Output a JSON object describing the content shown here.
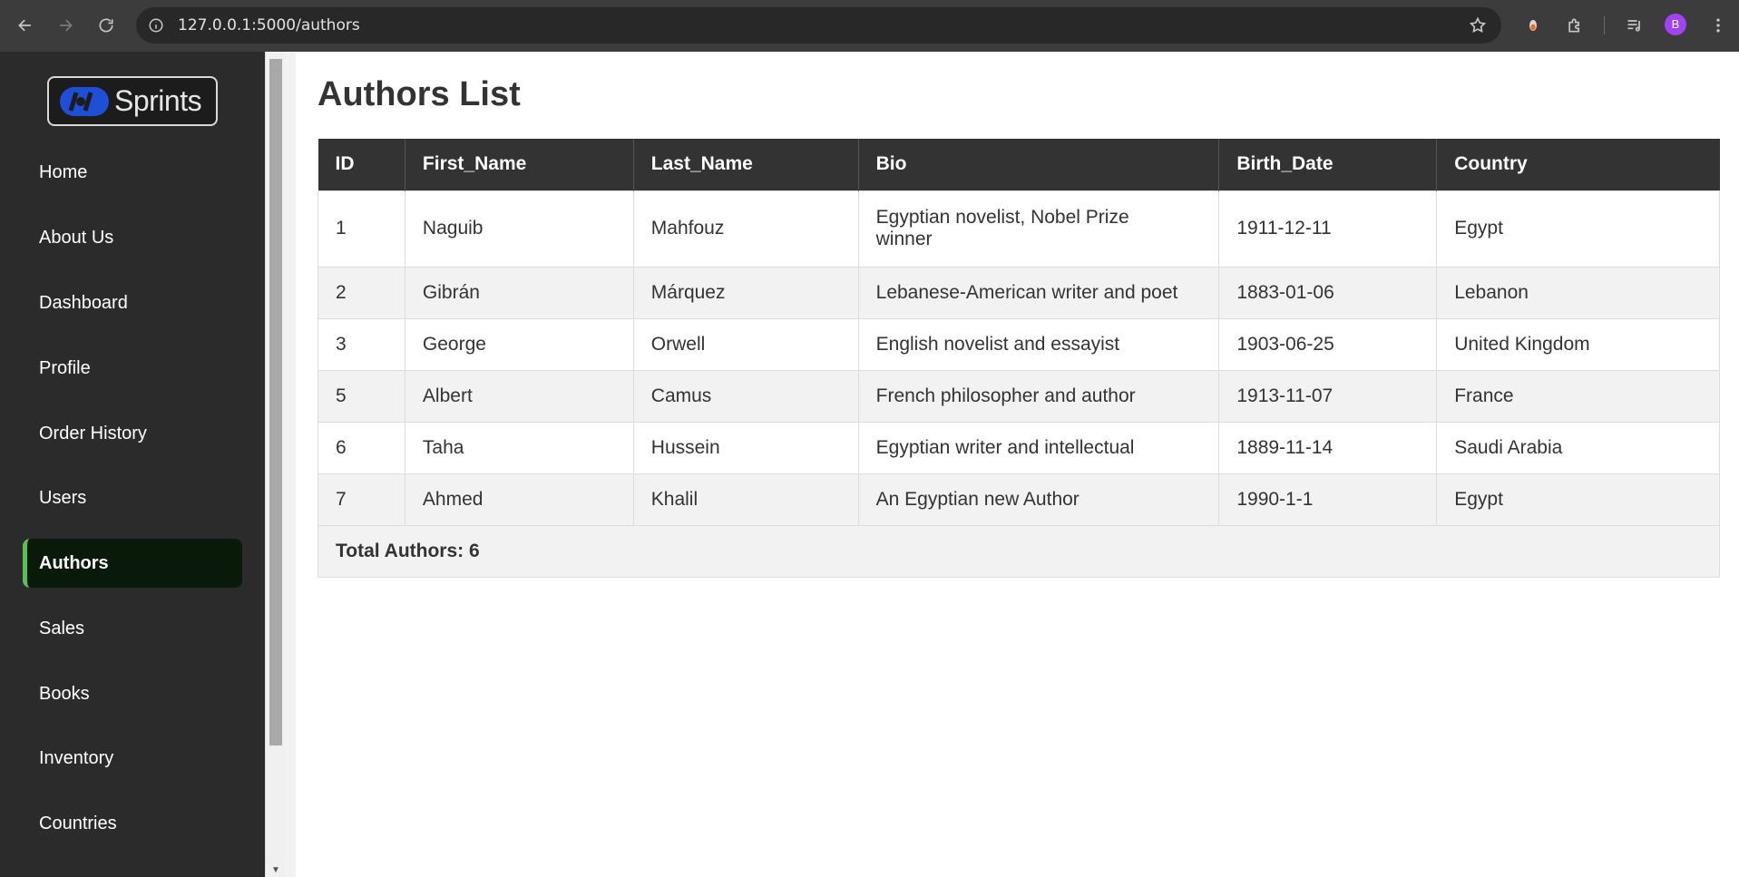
{
  "browser": {
    "url": "127.0.0.1:5000/authors",
    "profile_initial": "B"
  },
  "logo": {
    "text": "Sprints"
  },
  "sidebar": {
    "items": [
      {
        "label": "Home",
        "active": false
      },
      {
        "label": "About Us",
        "active": false
      },
      {
        "label": "Dashboard",
        "active": false
      },
      {
        "label": "Profile",
        "active": false
      },
      {
        "label": "Order History",
        "active": false
      },
      {
        "label": "Users",
        "active": false
      },
      {
        "label": "Authors",
        "active": true
      },
      {
        "label": "Sales",
        "active": false
      },
      {
        "label": "Books",
        "active": false
      },
      {
        "label": "Inventory",
        "active": false
      },
      {
        "label": "Countries",
        "active": false
      }
    ]
  },
  "main": {
    "title": "Authors List",
    "table": {
      "headers": [
        "ID",
        "First_Name",
        "Last_Name",
        "Bio",
        "Birth_Date",
        "Country"
      ],
      "rows": [
        [
          "1",
          "Naguib",
          "Mahfouz",
          "Egyptian novelist, Nobel Prize winner",
          "1911-12-11",
          "Egypt"
        ],
        [
          "2",
          "Gibrán",
          "Márquez",
          "Lebanese-American writer and poet",
          "1883-01-06",
          "Lebanon"
        ],
        [
          "3",
          "George",
          "Orwell",
          "English novelist and essayist",
          "1903-06-25",
          "United Kingdom"
        ],
        [
          "5",
          "Albert",
          "Camus",
          "French philosopher and author",
          "1913-11-07",
          "France"
        ],
        [
          "6",
          "Taha",
          "Hussein",
          "Egyptian writer and intellectual",
          "1889-11-14",
          "Saudi Arabia"
        ],
        [
          "7",
          "Ahmed",
          "Khalil",
          "An Egyptian new Author",
          "1990-1-1",
          "Egypt"
        ]
      ],
      "total": "Total Authors: 6"
    }
  },
  "colors": {
    "sidebar_bg": "#2b2b2b",
    "active_accent": "#56c15a",
    "table_header_bg": "#333333"
  }
}
